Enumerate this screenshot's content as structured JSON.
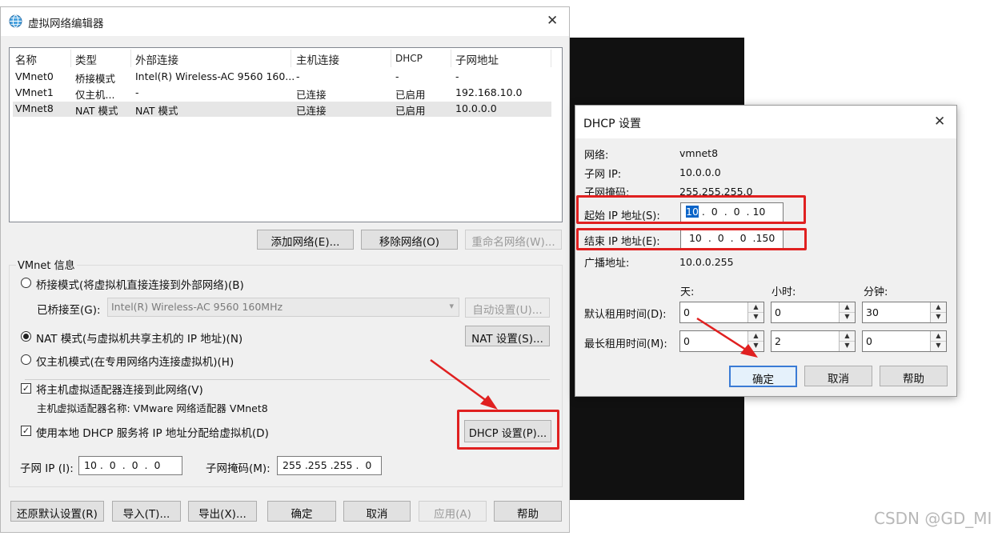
{
  "main": {
    "title": "虚拟网络编辑器",
    "columns": [
      "名称",
      "类型",
      "外部连接",
      "主机连接",
      "DHCP",
      "子网地址"
    ],
    "rows": [
      [
        "VMnet0",
        "桥接模式",
        "Intel(R) Wireless-AC 9560 160...",
        "-",
        "-",
        "-"
      ],
      [
        "VMnet1",
        "仅主机...",
        "-",
        "已连接",
        "已启用",
        "192.168.10.0"
      ],
      [
        "VMnet8",
        "NAT 模式",
        "NAT 模式",
        "已连接",
        "已启用",
        "10.0.0.0"
      ]
    ],
    "btn_add": "添加网络(E)...",
    "btn_remove": "移除网络(O)",
    "btn_rename": "重命名网络(W)...",
    "vmnet_info": "VMnet 信息",
    "radio_bridge": "桥接模式(将虚拟机直接连接到外部网络)(B)",
    "bridged_to": "已桥接至(G):",
    "bridged_adapter": "Intel(R) Wireless-AC 9560 160MHz",
    "btn_auto": "自动设置(U)...",
    "radio_nat": "NAT 模式(与虚拟机共享主机的 IP 地址)(N)",
    "btn_nat": "NAT 设置(S)...",
    "radio_host": "仅主机模式(在专用网络内连接虚拟机)(H)",
    "check_connect": "将主机虚拟适配器连接到此网络(V)",
    "adapter_name": "主机虚拟适配器名称: VMware 网络适配器 VMnet8",
    "check_dhcp": "使用本地 DHCP 服务将 IP 地址分配给虚拟机(D)",
    "btn_dhcp": "DHCP 设置(P)...",
    "subnet_ip_label": "子网 IP (I):",
    "subnet_ip": "10 .  0  .  0  .  0",
    "mask_label": "子网掩码(M):",
    "mask": "255 .255 .255 .  0",
    "btn_restore": "还原默认设置(R)",
    "btn_import": "导入(T)...",
    "btn_export": "导出(X)...",
    "btn_ok": "确定",
    "btn_cancel": "取消",
    "btn_apply": "应用(A)",
    "btn_help": "帮助"
  },
  "dhcp": {
    "title": "DHCP 设置",
    "network_label": "网络:",
    "network": "vmnet8",
    "subnet_ip_label": "子网 IP:",
    "subnet_ip": "10.0.0.0",
    "mask_label": "子网掩码:",
    "mask": "255.255.255.0",
    "start_label": "起始 IP 地址(S):",
    "start_first": "10",
    "start_rest": " .  0  .  0  . 10",
    "end_label": "结束 IP 地址(E):",
    "end": " 10  .  0  .  0  .150",
    "bcast_label": "广播地址:",
    "bcast": "10.0.0.255",
    "col_day": "天:",
    "col_hour": "小时:",
    "col_min": "分钟:",
    "default_lease_label": "默认租用时间(D):",
    "default_lease": [
      "0",
      "0",
      "30"
    ],
    "max_lease_label": "最长租用时间(M):",
    "max_lease": [
      "0",
      "2",
      "0"
    ],
    "btn_ok": "确定",
    "btn_cancel": "取消",
    "btn_help": "帮助"
  },
  "watermark": "CSDN @GD_MI",
  "colors": {
    "highlight": "#e02020",
    "arrow": "#e02020",
    "focus": "#3a7bd5"
  }
}
